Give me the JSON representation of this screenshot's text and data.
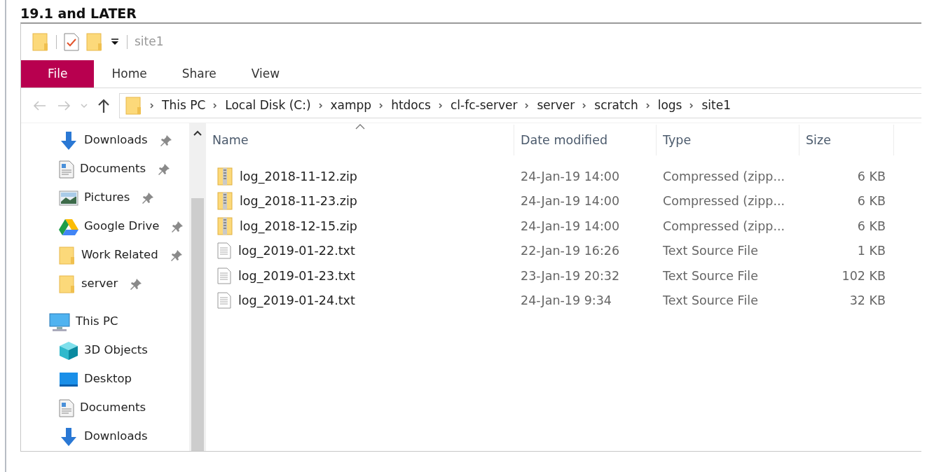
{
  "heading": "19.1 and LATER",
  "window": {
    "title": "site1"
  },
  "ribbon_tabs": [
    {
      "label": "File",
      "kind": "file"
    },
    {
      "label": "Home",
      "kind": "tab"
    },
    {
      "label": "Share",
      "kind": "tab"
    },
    {
      "label": "View",
      "kind": "tab"
    }
  ],
  "address": {
    "back_disabled": true,
    "forward_disabled": true,
    "path": [
      "This PC",
      "Local Disk (C:)",
      "xampp",
      "htdocs",
      "cl-fc-server",
      "server",
      "scratch",
      "logs",
      "site1"
    ]
  },
  "nav": {
    "quick_access": [
      {
        "label": "Downloads",
        "kind": "download",
        "pinned": true
      },
      {
        "label": "Documents",
        "kind": "document",
        "pinned": true
      },
      {
        "label": "Pictures",
        "kind": "picture",
        "pinned": true
      },
      {
        "label": "Google Drive",
        "kind": "drive",
        "pinned": true
      },
      {
        "label": "Work Related",
        "kind": "folder",
        "pinned": true
      },
      {
        "label": "server",
        "kind": "folder",
        "pinned": true
      }
    ],
    "this_pc": {
      "label": "This PC",
      "kind": "computer",
      "children": [
        {
          "label": "3D Objects",
          "kind": "cube"
        },
        {
          "label": "Desktop",
          "kind": "desktop"
        },
        {
          "label": "Documents",
          "kind": "document"
        },
        {
          "label": "Downloads",
          "kind": "download"
        }
      ]
    }
  },
  "columns": [
    {
      "label": "Name",
      "sorted": true
    },
    {
      "label": "Date modified",
      "sorted": false
    },
    {
      "label": "Type",
      "sorted": false
    },
    {
      "label": "Size",
      "sorted": false
    }
  ],
  "files": [
    {
      "name": "log_2018-11-12.zip",
      "kind": "zip",
      "date": "24-Jan-19 14:00",
      "type": "Compressed (zipp...",
      "size": "6 KB"
    },
    {
      "name": "log_2018-11-23.zip",
      "kind": "zip",
      "date": "24-Jan-19 14:00",
      "type": "Compressed (zipp...",
      "size": "6 KB"
    },
    {
      "name": "log_2018-12-15.zip",
      "kind": "zip",
      "date": "24-Jan-19 14:00",
      "type": "Compressed (zipp...",
      "size": "6 KB"
    },
    {
      "name": "log_2019-01-22.txt",
      "kind": "text",
      "date": "22-Jan-19 16:26",
      "type": "Text Source File",
      "size": "1 KB"
    },
    {
      "name": "log_2019-01-23.txt",
      "kind": "text",
      "date": "23-Jan-19 20:32",
      "type": "Text Source File",
      "size": "102 KB"
    },
    {
      "name": "log_2019-01-24.txt",
      "kind": "text",
      "date": "24-Jan-19 9:34",
      "type": "Text Source File",
      "size": "32 KB"
    }
  ]
}
